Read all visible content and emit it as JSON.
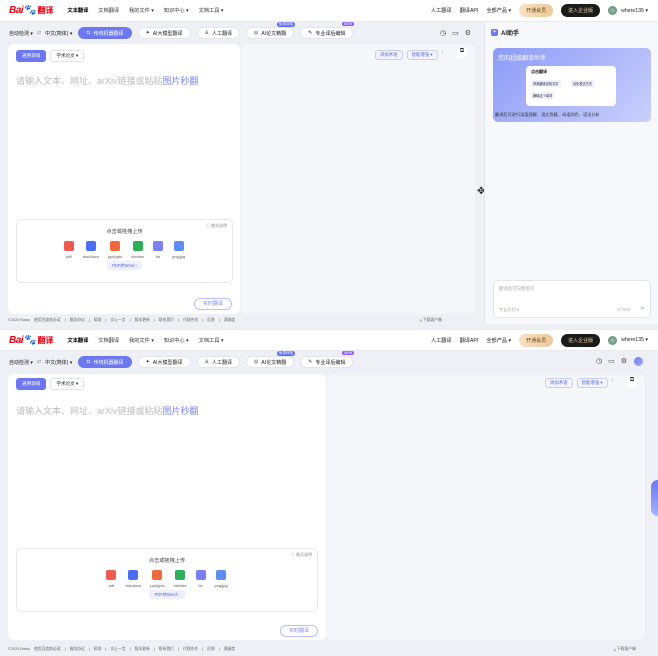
{
  "header": {
    "logo_text": "Bai",
    "logo_paw": "🐾",
    "logo_suffix": "翻译",
    "nav": [
      "文本翻译",
      "文档翻译",
      "我的文件 ▾",
      "知识中心 ▾",
      "文档工具 ▾"
    ],
    "right": [
      "人工翻译",
      "翻译API",
      "全部产品 ▾"
    ],
    "vip_label": "开通会员",
    "ent_label": "进入企业版",
    "username": "where135 ▾"
  },
  "toolbar": {
    "src_lang": "自动检测 ▾",
    "swap": "⇄",
    "tgt_lang": "中文(简体) ▾",
    "modes": [
      {
        "label": "传统机器翻译",
        "active": true
      },
      {
        "label": "AI大模型翻译",
        "active": false
      },
      {
        "label": "人工翻译",
        "active": false
      },
      {
        "label": "AI论文精翻",
        "active": false,
        "badge": "免费体验"
      },
      {
        "label": "专业译后编辑",
        "active": false,
        "badge": "NEW"
      }
    ]
  },
  "editor": {
    "domain_general": "通用领域",
    "domain_academic": "学术论文 ▾",
    "add_term": "添加术语",
    "smart_polish": "智能增强 ▾",
    "placeholder_main": "请输入文本、网址、arXiv链接或粘贴",
    "placeholder_hl": "图片秒翻",
    "upload_title": "点击或拖拽上传",
    "format_note": "格式说明",
    "filetypes": [
      {
        "label": "pdf",
        "color": "#ee5a4f"
      },
      {
        "label": "doc/docx",
        "color": "#4c6ef5"
      },
      {
        "label": "ppt/pptx",
        "color": "#f0693d"
      },
      {
        "label": "xls/xlsx",
        "color": "#2fae5a"
      },
      {
        "label": "txt",
        "color": "#7a7ff2"
      },
      {
        "label": "png/jpg",
        "color": "#5b8df5"
      }
    ],
    "pdf_to_word": "PDF转Word ›",
    "translate_btn": "实时翻译"
  },
  "ai": {
    "title": "AI助手",
    "card_title": "您的超级翻译伙伴",
    "card_inner_title": "点击翻译",
    "card_chip1": "帮我翻译这段文字",
    "card_chip2": "优化表达方式",
    "card_chip3": "解释这个单词",
    "desc": "翻译后可进行深度理解、语文答疑、母语润色、语法分析",
    "input_placeholder": "翻译后可向我提问",
    "input_hint": "专业识别 ▾",
    "counter": "0 / 500"
  },
  "footer": {
    "copyright": "©2025 Baidu",
    "links": [
      "使用百度前必读",
      "服务协议",
      "帮助",
      "文心一言",
      "版本更新",
      "联系我们",
      "代理合作",
      "反馈",
      "满意度"
    ],
    "download": "下载客户端"
  }
}
